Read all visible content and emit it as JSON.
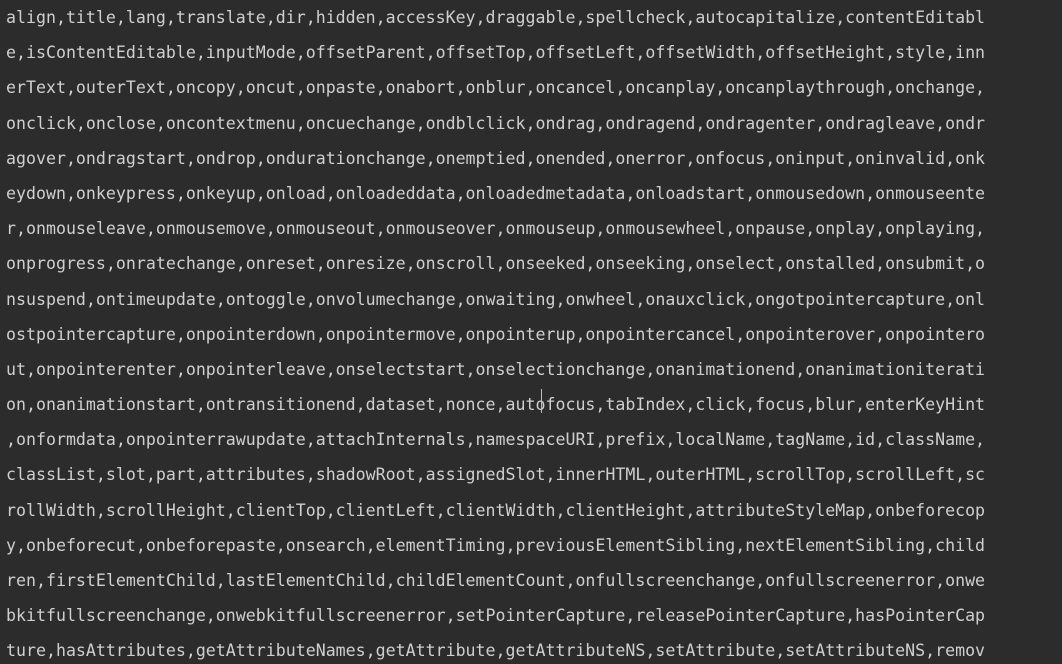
{
  "console_output": {
    "lines": [
      "align,title,lang,translate,dir,hidden,accessKey,draggable,spellcheck,autocapitalize,contentEditabl",
      "e,isContentEditable,inputMode,offsetParent,offsetTop,offsetLeft,offsetWidth,offsetHeight,style,inn",
      "erText,outerText,oncopy,oncut,onpaste,onabort,onblur,oncancel,oncanplay,oncanplaythrough,onchange,",
      "onclick,onclose,oncontextmenu,oncuechange,ondblclick,ondrag,ondragend,ondragenter,ondragleave,ondr",
      "agover,ondragstart,ondrop,ondurationchange,onemptied,onended,onerror,onfocus,oninput,oninvalid,onk",
      "eydown,onkeypress,onkeyup,onload,onloadeddata,onloadedmetadata,onloadstart,onmousedown,onmouseente",
      "r,onmouseleave,onmousemove,onmouseout,onmouseover,onmouseup,onmousewheel,onpause,onplay,onplaying,",
      "onprogress,onratechange,onreset,onresize,onscroll,onseeked,onseeking,onselect,onstalled,onsubmit,o",
      "nsuspend,ontimeupdate,ontoggle,onvolumechange,onwaiting,onwheel,onauxclick,ongotpointercapture,onl",
      "ostpointercapture,onpointerdown,onpointermove,onpointerup,onpointercancel,onpointerover,onpointero",
      "ut,onpointerenter,onpointerleave,onselectstart,onselectionchange,onanimationend,onanimationiterati",
      "on,onanimationstart,ontransitionend,dataset,nonce,autofocus,tabIndex,click,focus,blur,enterKeyHint",
      ",onformdata,onpointerrawupdate,attachInternals,namespaceURI,prefix,localName,tagName,id,className,",
      "classList,slot,part,attributes,shadowRoot,assignedSlot,innerHTML,outerHTML,scrollTop,scrollLeft,sc",
      "rollWidth,scrollHeight,clientTop,clientLeft,clientWidth,clientHeight,attributeStyleMap,onbeforecop",
      "y,onbeforecut,onbeforepaste,onsearch,elementTiming,previousElementSibling,nextElementSibling,child",
      "ren,firstElementChild,lastElementChild,childElementCount,onfullscreenchange,onfullscreenerror,onwe",
      "bkitfullscreenchange,onwebkitfullscreenerror,setPointerCapture,releasePointerCapture,hasPointerCap",
      "ture,hasAttributes,getAttributeNames,getAttribute,getAttributeNS,setAttribute,setAttributeNS,remov"
    ]
  },
  "colors": {
    "background": "#2c2c2c",
    "text": "#cfcfcf"
  }
}
